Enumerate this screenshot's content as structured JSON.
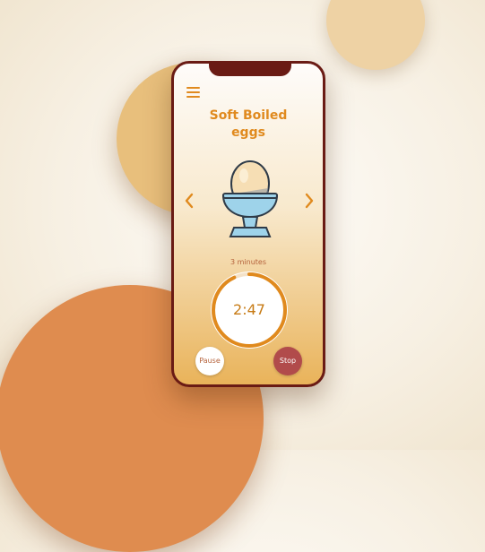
{
  "recipe": {
    "title_line1": "Soft Boiled",
    "title_line2": "eggs"
  },
  "timer": {
    "duration_label": "3 minutes",
    "remaining": "2:47",
    "progress": 0.93
  },
  "controls": {
    "pause_label": "Pause",
    "stop_label": "Stop"
  },
  "icons": {
    "menu": "hamburger-menu-icon",
    "prev": "chevron-left-icon",
    "next": "chevron-right-icon",
    "illustration": "egg-cup-icon"
  },
  "colors": {
    "accent": "#e08a1e",
    "phone_frame": "#6a1b14",
    "stop_button": "#b14b4b",
    "timer_ring": "#e08a1e"
  }
}
